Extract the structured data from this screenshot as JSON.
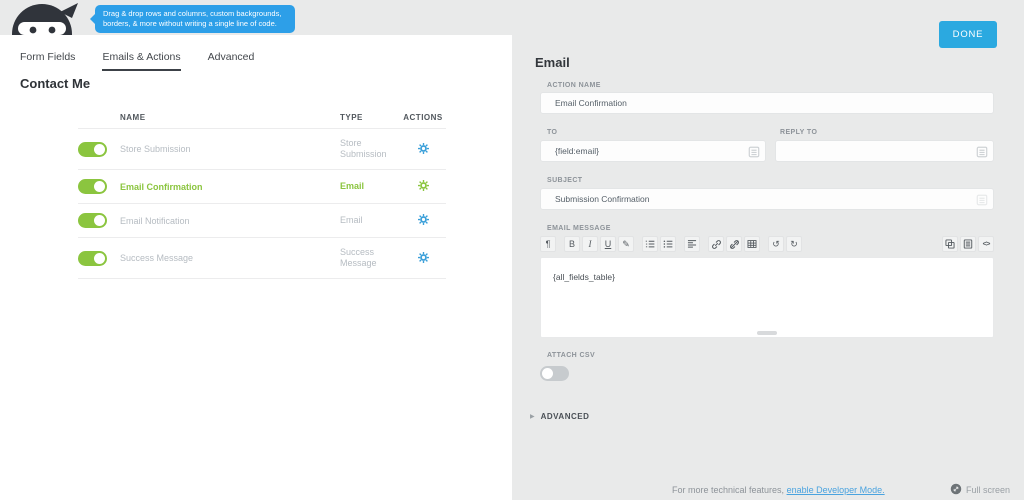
{
  "header": {
    "tooltip_line1": "Drag & drop rows and columns, custom backgrounds,",
    "tooltip_line2": "borders, & more without writing a single line of code.",
    "done_label": "DONE"
  },
  "tabs": {
    "form_fields": "Form Fields",
    "emails_actions": "Emails & Actions",
    "advanced": "Advanced"
  },
  "left": {
    "form_title": "Contact Me",
    "table": {
      "headers": {
        "name": "NAME",
        "type": "TYPE",
        "actions": "ACTIONS"
      },
      "rows": [
        {
          "name": "Store Submission",
          "type": "Store Submission",
          "enabled": true,
          "selected": false
        },
        {
          "name": "Email Confirmation",
          "type": "Email",
          "enabled": true,
          "selected": true
        },
        {
          "name": "Email Notification",
          "type": "Email",
          "enabled": true,
          "selected": false
        },
        {
          "name": "Success Message",
          "type": "Success Message",
          "enabled": true,
          "selected": false
        }
      ]
    }
  },
  "panel": {
    "title": "Email",
    "action_name": {
      "label": "ACTION NAME",
      "value": "Email Confirmation"
    },
    "to": {
      "label": "TO",
      "value": "{field:email}"
    },
    "reply_to": {
      "label": "REPLY TO",
      "value": ""
    },
    "subject": {
      "label": "SUBJECT",
      "value": "Submission Confirmation"
    },
    "email_message": {
      "label": "EMAIL MESSAGE",
      "value": "{all_fields_table}"
    },
    "attach_csv": {
      "label": "ATTACH CSV",
      "enabled": false
    },
    "advanced_label": "ADVANCED",
    "advanced_arrow": "▶"
  },
  "toolbar": {
    "glyphs": {
      "paragraph": "¶",
      "bold": "B",
      "italic": "I",
      "underline": "U",
      "remove_format": "✎",
      "undo": "↺",
      "redo": "↻",
      "code": "<>"
    }
  },
  "footer": {
    "text": "For more technical features, ",
    "link_label": "enable Developer Mode.",
    "fullscreen_label": "Full screen"
  },
  "colors": {
    "accent_blue": "#2ba9e0",
    "tooltip_blue": "#2d9fe8",
    "green": "#8bc53f",
    "panel_gray": "#e9eaea"
  }
}
